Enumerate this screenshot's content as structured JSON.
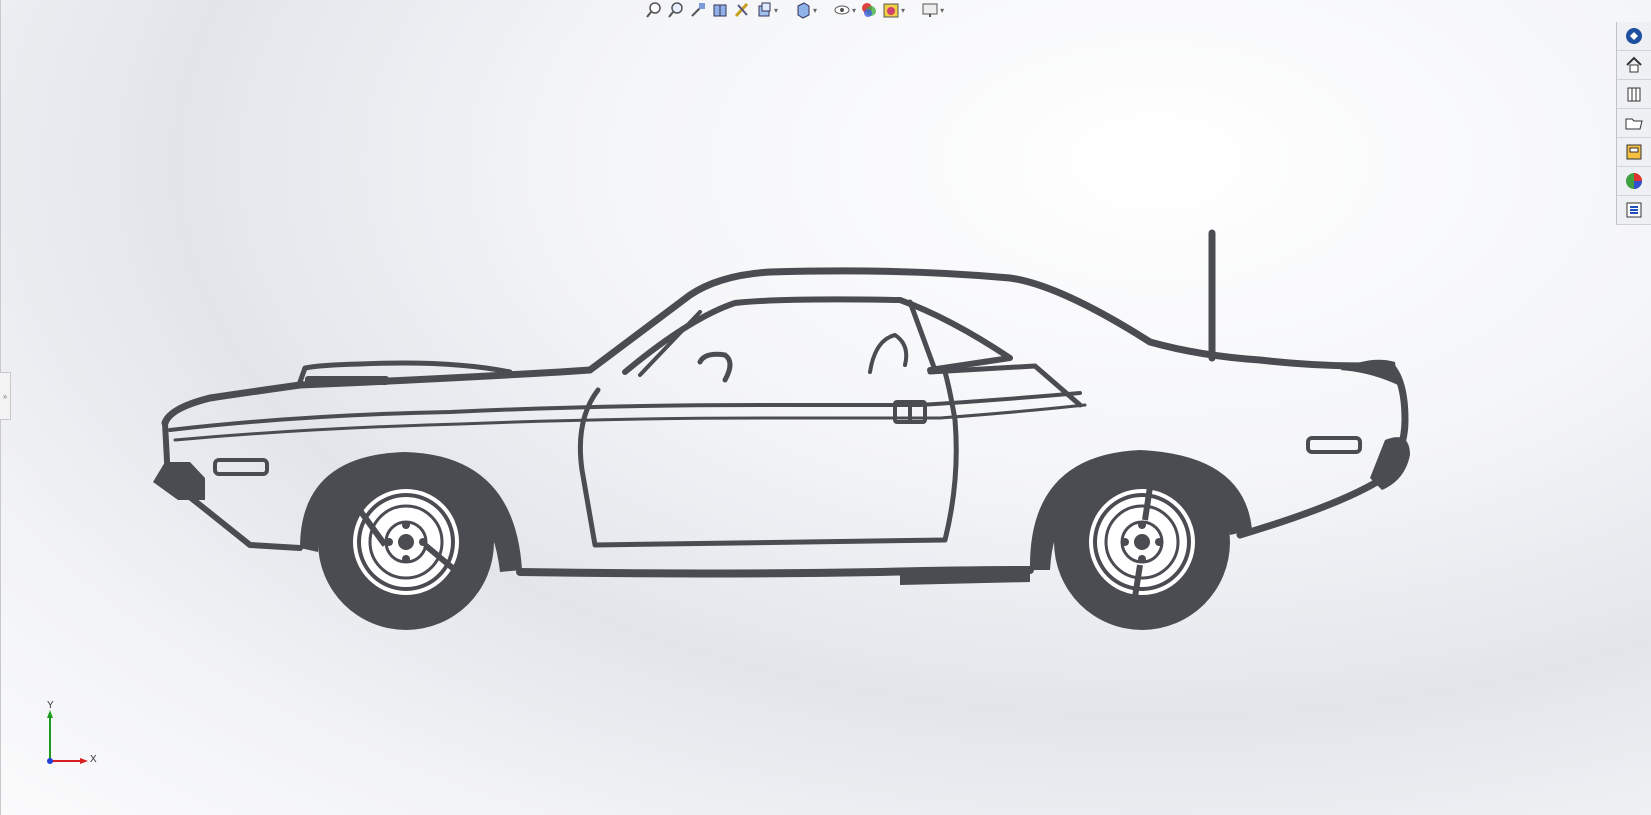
{
  "hud_toolbar": {
    "items": [
      {
        "name": "zoom-to-fit-icon"
      },
      {
        "name": "zoom-to-area-icon"
      },
      {
        "name": "previous-view-icon"
      },
      {
        "name": "section-view-icon"
      },
      {
        "name": "dynamic-annotation-icon"
      },
      {
        "name": "view-orientation-icon",
        "dropdown": true
      },
      {
        "name": "display-style-icon",
        "dropdown": true
      },
      {
        "name": "hide-show-items-icon",
        "dropdown": true
      },
      {
        "name": "edit-appearance-icon"
      },
      {
        "name": "apply-scene-icon",
        "dropdown": true
      },
      {
        "name": "view-settings-icon",
        "dropdown": true
      }
    ]
  },
  "task_pane": {
    "items": [
      {
        "name": "solidworks-resources-icon"
      },
      {
        "name": "home-icon"
      },
      {
        "name": "design-library-icon"
      },
      {
        "name": "file-explorer-icon"
      },
      {
        "name": "view-palette-icon"
      },
      {
        "name": "appearances-scenes-icon"
      },
      {
        "name": "custom-properties-icon"
      }
    ]
  },
  "triad": {
    "x_label": "X",
    "y_label": "Y"
  },
  "colors": {
    "outline": "#4b4c52",
    "fill": "#4b4c52",
    "body_fill": "#ffffff",
    "axis_x": "#d82020",
    "axis_y": "#1f9a1f",
    "axis_z": "#2040d8"
  }
}
